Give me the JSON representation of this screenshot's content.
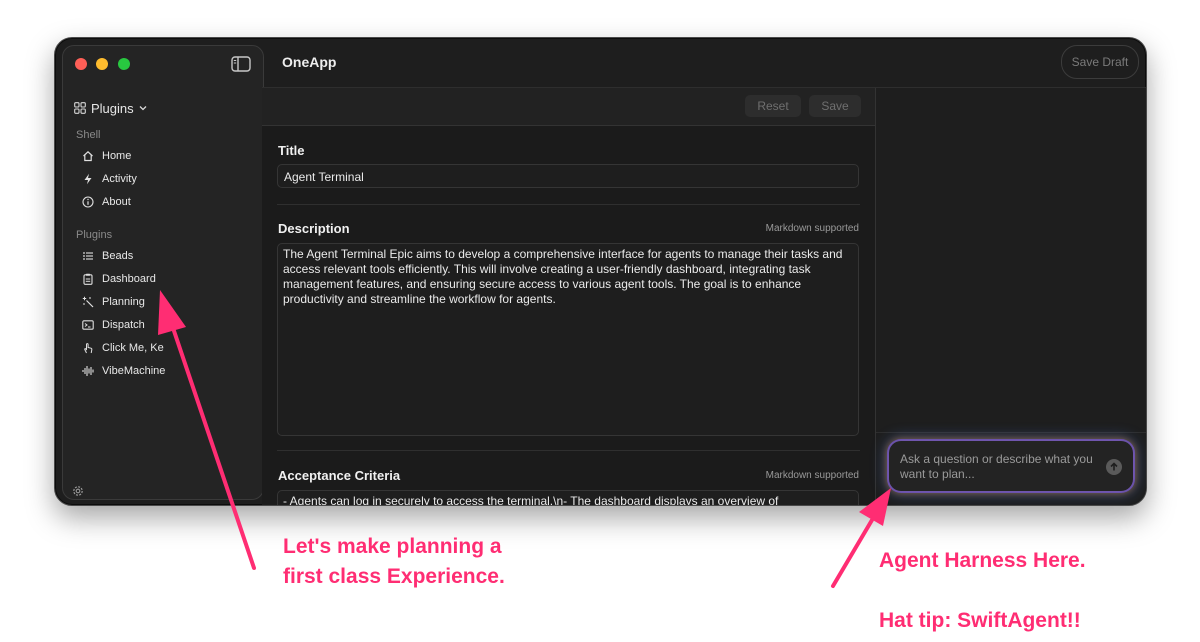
{
  "window": {
    "app_title": "OneApp",
    "save_draft_label": "Save Draft"
  },
  "sidebar": {
    "switcher_label": "Plugins",
    "sections": [
      {
        "label": "Shell",
        "items": [
          {
            "label": "Home",
            "icon": "house-icon"
          },
          {
            "label": "Activity",
            "icon": "bolt-icon"
          },
          {
            "label": "About",
            "icon": "info-icon"
          }
        ]
      },
      {
        "label": "Plugins",
        "items": [
          {
            "label": "Beads",
            "icon": "list-icon"
          },
          {
            "label": "Dashboard",
            "icon": "clipboard-icon"
          },
          {
            "label": "Planning",
            "icon": "sparkle-wand-icon"
          },
          {
            "label": "Dispatch",
            "icon": "terminal-icon"
          },
          {
            "label": "Click Me, Ke",
            "icon": "tap-hand-icon"
          },
          {
            "label": "VibeMachine",
            "icon": "waveform-icon"
          }
        ]
      }
    ]
  },
  "form": {
    "reset_label": "Reset",
    "save_label": "Save",
    "title_label": "Title",
    "title_value": "Agent Terminal",
    "description_label": "Description",
    "description_hint": "Markdown supported",
    "description_value": "The Agent Terminal Epic aims to develop a comprehensive interface for agents to manage their tasks and access relevant tools efficiently. This will involve creating a user-friendly dashboard, integrating task management features, and ensuring secure access to various agent tools. The goal is to enhance productivity and streamline the workflow for agents.",
    "criteria_label": "Acceptance Criteria",
    "criteria_hint": "Markdown supported",
    "criteria_value": "- Agents can log in securely to access the terminal.\\n- The dashboard displays an overview of"
  },
  "chat": {
    "placeholder": "Ask a question or describe what you want to plan..."
  },
  "annotations": {
    "left_line1": "Let's make planning a",
    "left_line2": "first class Experience.",
    "right_line1": "Agent Harness Here.",
    "right_line2": "Hat tip: SwiftAgent!!"
  },
  "colors": {
    "annotation": "#ff2d73",
    "window_bg": "#1e1e1e",
    "sidebar_bg": "#242424"
  }
}
